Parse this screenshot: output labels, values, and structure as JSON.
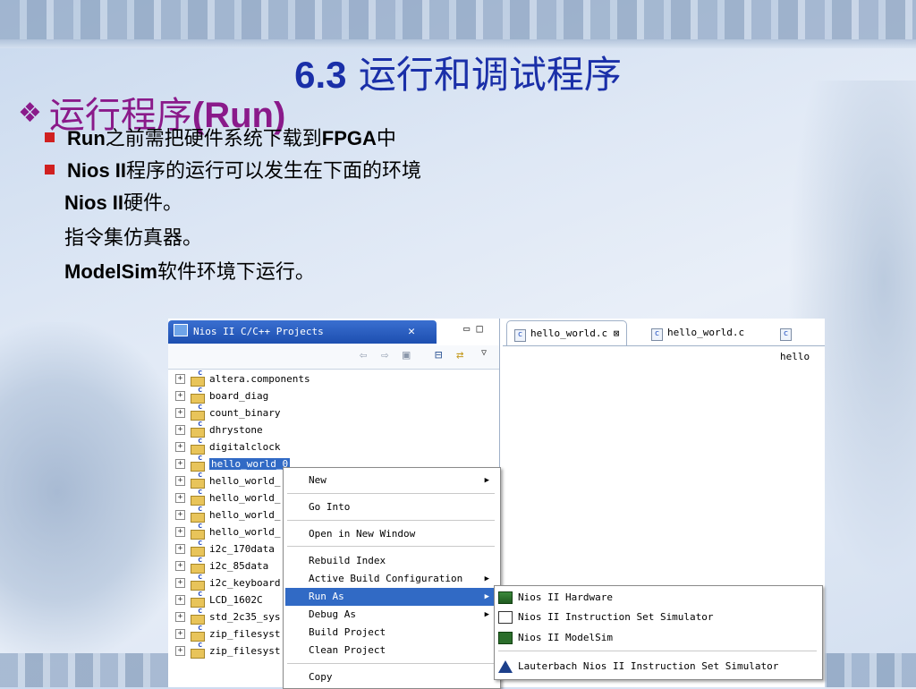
{
  "slide": {
    "title_num": "6.3",
    "title_text": "运行和调试程序",
    "subtitle_bullet": "❖",
    "subtitle_cn": "运行程序",
    "subtitle_en": "(Run)",
    "bullets": [
      {
        "strong": "Run",
        "text": "之前需把硬件系统下载到",
        "strong2": "FPGA",
        "text2": "中"
      },
      {
        "strong": "Nios II",
        "text": "程序的运行可以发生在下面的环境"
      }
    ],
    "items": [
      {
        "strong": "Nios II",
        "text": "硬件。"
      },
      {
        "text": "指令集仿真器。"
      },
      {
        "strong": "ModelSim",
        "text": "软件环境下运行。"
      }
    ]
  },
  "eclipse": {
    "project_view_title": "Nios II C/C++ Projects",
    "close_glyph": "✕",
    "pane_min": "▭",
    "pane_max": "□",
    "tree": [
      "altera.components",
      "board_diag",
      "count_binary",
      "dhrystone",
      "digitalclock",
      "hello_world_0",
      "hello_world_",
      "hello_world_",
      "hello_world_",
      "hello_world_",
      "i2c_170data",
      "i2c_85data",
      "i2c_keyboard",
      "LCD_1602C",
      "std_2c35_sys",
      "zip_filesyst",
      "zip_filesyst"
    ],
    "editor_tabs": [
      "hello_world.c",
      "hello_world.c",
      "hello"
    ],
    "tab_close": "⊠",
    "context_menu": [
      {
        "label": "New",
        "submenu": true
      },
      {
        "label": "Go Into",
        "submenu": false
      },
      {
        "label": "Open in New Window",
        "submenu": false
      },
      {
        "label": "Rebuild Index",
        "submenu": false
      },
      {
        "label": "Active Build Configuration",
        "submenu": true
      },
      {
        "label": "Run As",
        "submenu": true
      },
      {
        "label": "Debug As",
        "submenu": true
      },
      {
        "label": "Build Project",
        "submenu": false
      },
      {
        "label": "Clean Project",
        "submenu": false
      },
      {
        "label": "Copy",
        "submenu": false
      }
    ],
    "run_as_menu": [
      "Nios II Hardware",
      "Nios II Instruction Set Simulator",
      "Nios II ModelSim",
      "Lauterbach Nios II Instruction Set Simulator"
    ]
  }
}
